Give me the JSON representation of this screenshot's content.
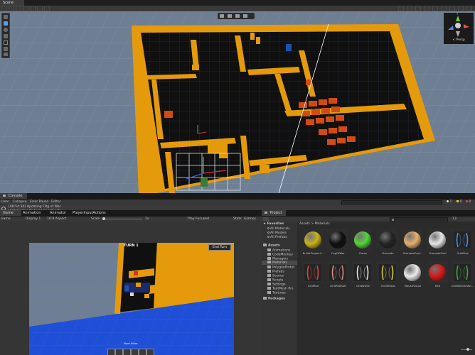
{
  "scene": {
    "tab_label": "Scene",
    "persp_label": "< Persp",
    "gizmo_axes": {
      "y": "y",
      "x": "x",
      "z": "z"
    },
    "tools": [
      "hand-tool",
      "move-tool",
      "rotate-tool",
      "scale-tool",
      "rect-tool",
      "transform-tool",
      "custom-tool"
    ]
  },
  "console": {
    "tab_label": "Console",
    "buttons": {
      "clear": "Clear",
      "collapse": "Collapse",
      "error_pause": "Error Pause",
      "editor": "Editor"
    },
    "counts": {
      "info": "1",
      "warning": "0",
      "error": "0"
    },
    "messages": [
      {
        "line1": "[08:54:30] Updating FOg of War",
        "line2": "UnityEngine.Debug:Log (object)"
      }
    ]
  },
  "game": {
    "tabs": [
      "Game",
      "Animation",
      "Animator",
      "PlayerInputActions (Input..."
    ],
    "display_mode": "Game",
    "display": "Display 1",
    "aspect": "16:9 Aspect",
    "scale_label": "Scale",
    "scale_value": "2x",
    "play_mode": "Play Focused",
    "stats": "Stats",
    "gizmos": "Gizmos",
    "turn_label": "TURN 1",
    "end_turn_label": "End Turn",
    "unit_label": "Move Action",
    "hotbar_slots": 6
  },
  "project": {
    "tab_label": "Project",
    "search_placeholder": "",
    "breadcrumb": [
      "Assets",
      "Materials"
    ],
    "item_count": "13",
    "favorites": {
      "label": "Favorites",
      "items": [
        "All Materials",
        "All Models",
        "All Prefabs"
      ]
    },
    "assets": {
      "label": "Assets",
      "items": [
        "Animations",
        "CodeMonkey",
        "Managers",
        "Materials",
        "PolygonProtot",
        "Prefabs",
        "Scenes",
        "Scripts",
        "Settings",
        "TextMesh Pro",
        "Textures"
      ]
    },
    "packages_label": "Packages",
    "materials": [
      {
        "name": "BulletProjectil...",
        "color": "#c9b21b",
        "kind": "ball"
      },
      {
        "name": "FogOfWar",
        "color": "#0e0e0e",
        "kind": "ball"
      },
      {
        "name": "Green",
        "color": "#54d43a",
        "kind": "ball"
      },
      {
        "name": "Grenade",
        "color": "#242424",
        "kind": "ball"
      },
      {
        "name": "GrenadeExpl...",
        "color": "#e8b06a",
        "kind": "ball"
      },
      {
        "name": "GrenadeTrail",
        "color": "#e6e6e6",
        "kind": "ball"
      },
      {
        "name": "GridBlue",
        "color": "#4a8adf",
        "kind": "grid"
      },
      {
        "name": "GridRed",
        "color": "#d44545",
        "kind": "grid"
      },
      {
        "name": "GridRedSoft",
        "color": "#d88a8a",
        "kind": "grid"
      },
      {
        "name": "GridWhite",
        "color": "#e4e4e4",
        "kind": "grid"
      },
      {
        "name": "GridYellow",
        "color": "#d8c84a",
        "kind": "grid"
      },
      {
        "name": "MouseVisual",
        "color": "#ececec",
        "kind": "ball"
      },
      {
        "name": "Red",
        "color": "#d81818",
        "kind": "ball"
      },
      {
        "name": "UnitSelectedVi...",
        "color": "#3ea83e",
        "kind": "grid"
      }
    ]
  },
  "colors": {
    "wall": "#e59a0c",
    "floor": "#101010",
    "grid_plane": "#6f7f93",
    "crate": "#d24b12",
    "bg": "#282828",
    "tabbar": "#1e1e1e"
  }
}
